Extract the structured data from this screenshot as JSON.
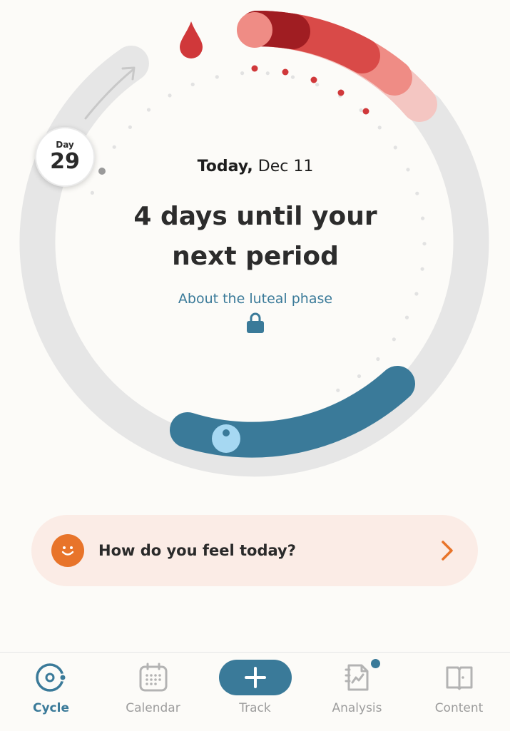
{
  "cycle": {
    "day_label": "Day",
    "day_number": "29",
    "progress_days_until_period": 4
  },
  "today": {
    "prefix": "Today,",
    "date": "Dec 11"
  },
  "headline": {
    "line1": "4 days until your",
    "line2": "next period"
  },
  "phase_link": {
    "label": "About the luteal phase",
    "icon": "lock-icon"
  },
  "feel_card": {
    "label": "How do you feel today?",
    "icon": "smiley-face-icon",
    "chevron": "chevron-right-icon"
  },
  "tabs": [
    {
      "label": "Cycle",
      "icon": "cycle-icon",
      "active": true
    },
    {
      "label": "Calendar",
      "icon": "calendar-icon",
      "active": false
    },
    {
      "label": "Track",
      "icon": "plus-icon",
      "active": false
    },
    {
      "label": "Analysis",
      "icon": "analysis-icon",
      "active": false,
      "notification": true
    },
    {
      "label": "Content",
      "icon": "book-icon",
      "active": false
    }
  ],
  "colors": {
    "accent": "#3a7a99",
    "period_dark": "#9c1c22",
    "period": "#d94a48",
    "period_light": "#f4c6c2",
    "fertile": "#3a7a99",
    "ovulation": "#a6d8f2",
    "track_ring": "#e6e6e6",
    "feel_card_bg": "#fbece6",
    "feel_icon": "#e8742a"
  }
}
